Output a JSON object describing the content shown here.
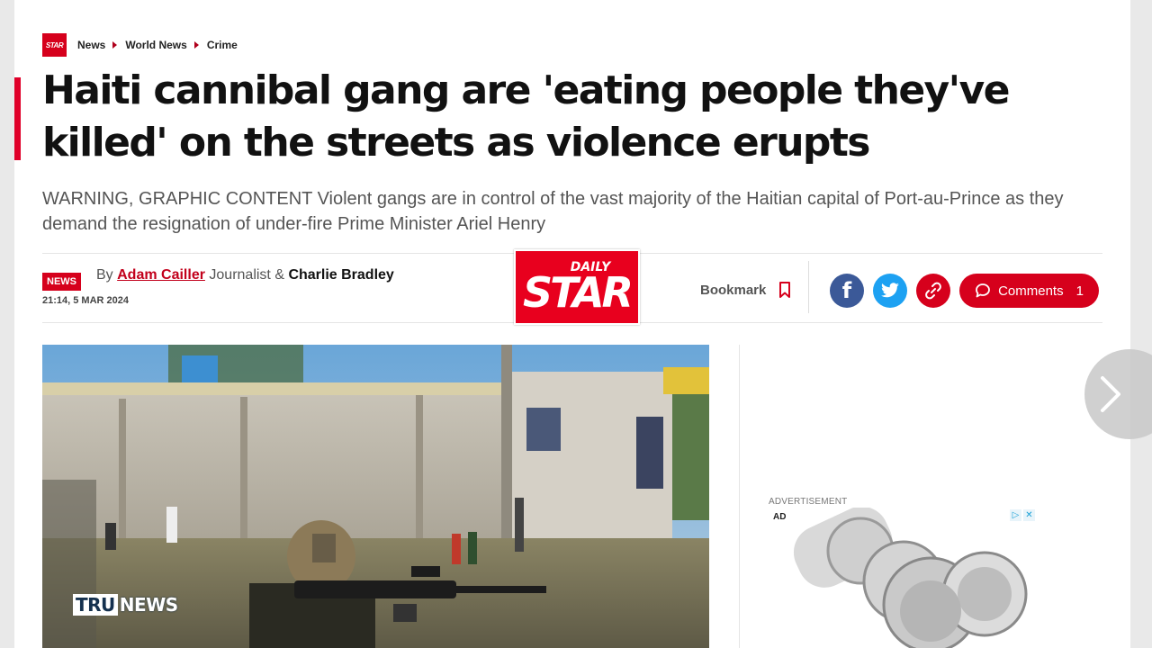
{
  "breadcrumb": {
    "logo_text": "STAR",
    "items": [
      "News",
      "World News",
      "Crime"
    ]
  },
  "article": {
    "headline": "Haiti cannibal gang are 'eating people they've killed' on the streets as violence erupts",
    "standfirst": "WARNING, GRAPHIC CONTENT Violent gangs are in control of the vast majority of the Haitian capital of Port-au-Prince as they demand the resignation of under-fire Prime Minister Ariel Henry",
    "badge": "NEWS",
    "byline_prefix": "By",
    "author1": "Adam Cailler",
    "author1_role": "Journalist &",
    "author2": "Charlie Bradley",
    "dateline": "21:14, 5 MAR 2024"
  },
  "brand": {
    "daily": "DAILY",
    "star": "STAR"
  },
  "actions": {
    "bookmark_label": "Bookmark",
    "comments_label": "Comments",
    "comments_count": "1"
  },
  "ad": {
    "label": "ADVERTISEMENT",
    "tag": "AD"
  },
  "overlay": {
    "watermark_tru": "TRU",
    "watermark_news": "NEWS"
  },
  "icons": {
    "facebook": "facebook-icon",
    "twitter": "twitter-icon",
    "link": "link-icon",
    "comment": "comment-icon",
    "bookmark": "bookmark-icon",
    "next": "chevron-right-icon"
  },
  "colors": {
    "brand_red": "#d6001c",
    "facebook": "#3b5998",
    "twitter": "#1da1f2"
  }
}
